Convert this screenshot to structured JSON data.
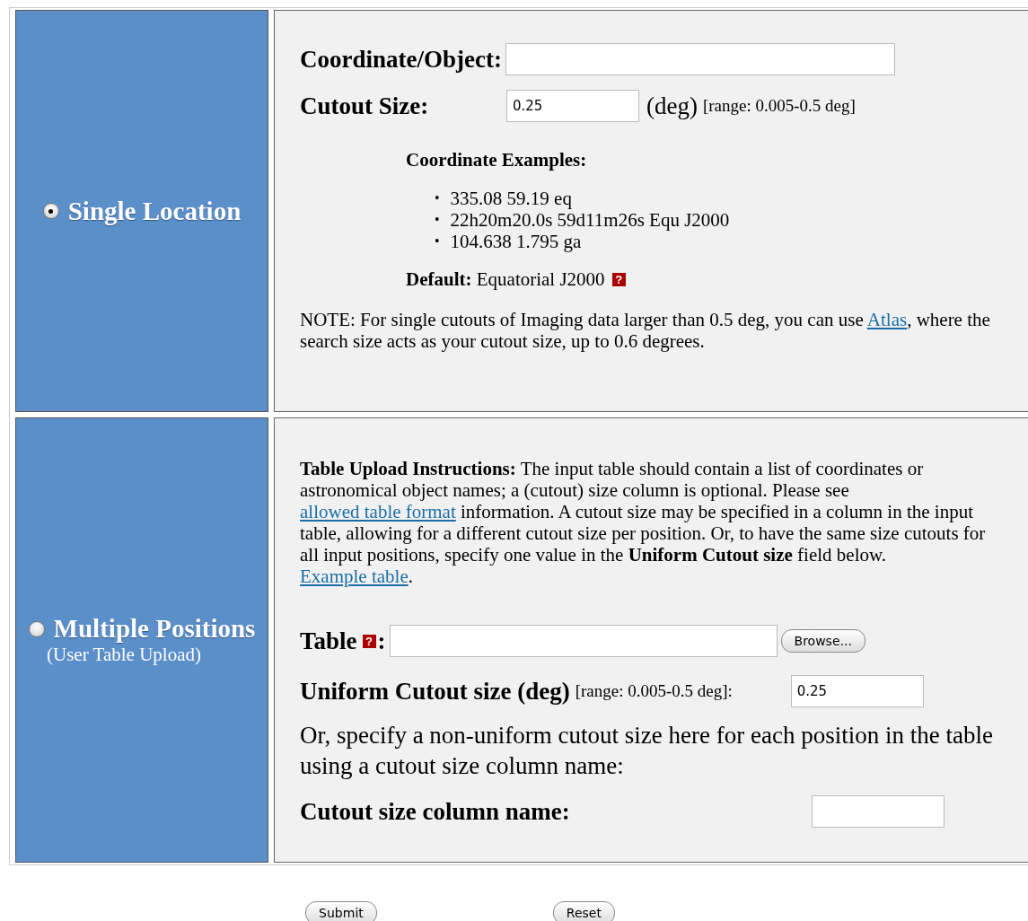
{
  "single": {
    "option": {
      "label": "Single Location",
      "selected": true
    },
    "coordinate": {
      "label": "Coordinate/Object:"
    },
    "cutout": {
      "label": "Cutout Size:",
      "value": "0.25",
      "unit": "(deg)",
      "range": "[range: 0.005-0.5 deg]"
    },
    "examples": {
      "heading": "Coordinate Examples:",
      "items": [
        {
          "bullet": "•",
          "text": "335.08 59.19 eq"
        },
        {
          "bullet": "•",
          "text": "22h20m20.0s 59d11m26s Equ J2000"
        },
        {
          "bullet": "•",
          "text": "104.638 1.795 ga"
        }
      ]
    },
    "default": {
      "text": "**Default:** Equatorial J2000",
      "help_icon": "?"
    },
    "note": [
      {
        "kind": "text",
        "text": "NOTE: For single cutouts of Imaging data larger than 0.5 deg, you can use "
      },
      {
        "kind": "link",
        "text": "Atlas"
      },
      {
        "kind": "text",
        "text": ", where the search size acts as your cutout size, up to 0.6 degrees."
      }
    ]
  },
  "multiple": {
    "option": {
      "label": "Multiple Positions",
      "sublabel": "(User Table Upload)",
      "selected": false
    },
    "instructions": [
      {
        "kind": "text",
        "text": "**Table Upload Instructions:** The input table should contain a list of coordinates or astronomical object names; a (cutout) size column is optional. Please see "
      },
      {
        "kind": "link",
        "text": "allowed table format"
      },
      {
        "kind": "text",
        "text": " information. A cutout size may be specified in a column in the input table, allowing for a different cutout size per position. Or, to have the same size cutouts for all input positions, specify one value in the **Uniform Cutout size** field below. "
      },
      {
        "kind": "link",
        "text": "Example table"
      },
      {
        "kind": "text",
        "text": "."
      }
    ],
    "table": {
      "label": "Table",
      "help_icon": "?",
      "colon": ":",
      "browse": "Browse..."
    },
    "uniform": {
      "label": "Uniform Cutout size (deg)",
      "range": "[range: 0.005-0.5 deg]:",
      "value": "0.25"
    },
    "hint": "Or, specify a non-uniform cutout size here for each position in the table using a cutout size column name:",
    "column": {
      "label": "Cutout size column name:"
    }
  },
  "buttons": [
    "Submit",
    "Reset"
  ]
}
